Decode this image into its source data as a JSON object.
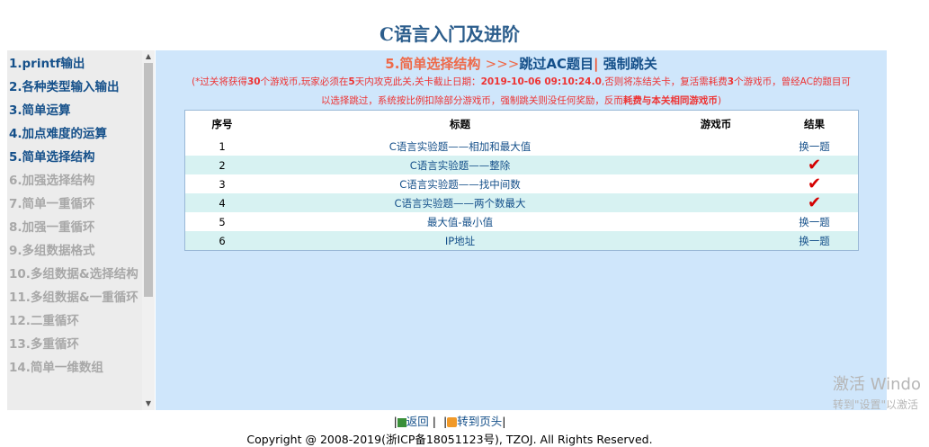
{
  "page_title": "C语言入门及进阶",
  "sidebar": {
    "items": [
      {
        "label": "1.printf输出",
        "state": "active"
      },
      {
        "label": "2.各种类型输入输出",
        "state": "active"
      },
      {
        "label": "3.简单运算",
        "state": "active"
      },
      {
        "label": "4.加点难度的运算",
        "state": "active"
      },
      {
        "label": "5.简单选择结构",
        "state": "active"
      },
      {
        "label": "6.加强选择结构",
        "state": "locked"
      },
      {
        "label": "7.简单一重循环",
        "state": "locked"
      },
      {
        "label": "8.加强一重循环",
        "state": "locked"
      },
      {
        "label": "9.多组数据格式",
        "state": "locked"
      },
      {
        "label": "10.多组数据&选择结构",
        "state": "locked"
      },
      {
        "label": "11.多组数据&一重循环",
        "state": "locked"
      },
      {
        "label": "12.二重循环",
        "state": "locked"
      },
      {
        "label": "13.多重循环",
        "state": "locked"
      },
      {
        "label": "14.简单一维数组",
        "state": "locked"
      }
    ]
  },
  "stage": {
    "name": "5.简单选择结构",
    "arrows": ">>>",
    "skip_label": "跳过AC题目",
    "separator": "|",
    "force_skip_label": "强制跳关"
  },
  "notice": {
    "p1": "(*过关将获得",
    "coins": "30",
    "p2": "个游戏币,玩家必须在",
    "days": "5",
    "p3": "天内攻克此关,关卡截止日期：",
    "deadline": "2019-10-06 09:10:24.0",
    "p4": ",否则将冻结关卡，复活需耗费",
    "revive": "3",
    "p5": "个游戏币，曾经AC的题目可",
    "line2": "以选择跳过，系统按比例扣除部分游戏币，强制跳关则没任何奖励，反而",
    "line2_bold": "耗费与本关相同游戏币",
    "line2_end": ")"
  },
  "table": {
    "headers": [
      "序号",
      "标题",
      "游戏币",
      "结果"
    ],
    "rows": [
      {
        "no": "1",
        "title": "C语言实验题——相加和最大值",
        "coins": "",
        "result": "换一题",
        "result_type": "link"
      },
      {
        "no": "2",
        "title": "C语言实验题——整除",
        "coins": "",
        "result": "✔",
        "result_type": "check"
      },
      {
        "no": "3",
        "title": "C语言实验题——找中间数",
        "coins": "",
        "result": "✔",
        "result_type": "check"
      },
      {
        "no": "4",
        "title": "C语言实验题——两个数最大",
        "coins": "",
        "result": "✔",
        "result_type": "check"
      },
      {
        "no": "5",
        "title": "最大值-最小值",
        "coins": "",
        "result": "换一题",
        "result_type": "link"
      },
      {
        "no": "6",
        "title": "IP地址",
        "coins": "",
        "result": "换一题",
        "result_type": "link"
      }
    ]
  },
  "footer": {
    "back_label": "返回",
    "top_label": "转到页头",
    "pipe": "|",
    "copyright": "Copyright @ 2008-2019(浙ICP备18051123号), TZOJ. All Rights Reserved."
  },
  "watermark": {
    "line1": "激活 Windo",
    "line2": "转到\"设置\"以激活"
  },
  "colors": {
    "accent": "#15508a",
    "stage": "#ee6a4a",
    "notice": "#e33333",
    "panel": "#cfe6fb",
    "row_alt": "#d7f2f2"
  }
}
